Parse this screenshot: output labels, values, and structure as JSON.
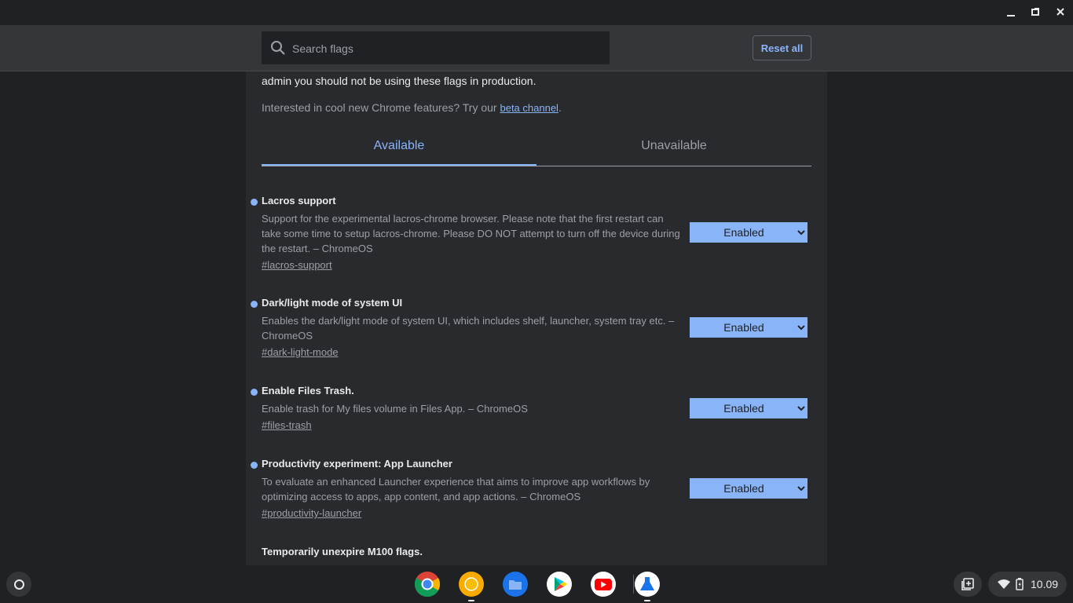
{
  "window": {
    "controls": [
      {
        "name": "minimize-icon"
      },
      {
        "name": "maximize-icon"
      },
      {
        "name": "close-icon"
      }
    ]
  },
  "toolbar": {
    "search_placeholder": "Search flags",
    "search_value": "",
    "reset_label": "Reset all"
  },
  "intro": {
    "warning_text": "admin you should not be using these flags in production.",
    "beta_prefix": "Interested in cool new Chrome features? Try our ",
    "beta_link": "beta channel",
    "beta_suffix": "."
  },
  "tabs": [
    {
      "label": "Available",
      "active": true
    },
    {
      "label": "Unavailable",
      "active": false
    }
  ],
  "flags": [
    {
      "name": "Lacros support",
      "description": "Support for the experimental lacros-chrome browser. Please note that the first restart can take some time to setup lacros-chrome. Please DO NOT attempt to turn off the device during the restart. – ChromeOS",
      "link": "#lacros-support",
      "value": "Enabled"
    },
    {
      "name": "Dark/light mode of system UI",
      "description": "Enables the dark/light mode of system UI, which includes shelf, launcher, system tray etc. – ChromeOS",
      "link": "#dark-light-mode",
      "value": "Enabled"
    },
    {
      "name": "Enable Files Trash.",
      "description": "Enable trash for My files volume in Files App. – ChromeOS",
      "link": "#files-trash",
      "value": "Enabled"
    },
    {
      "name": "Productivity experiment: App Launcher",
      "description": "To evaluate an enhanced Launcher experience that aims to improve app workflows by optimizing access to apps, app content, and app actions. – ChromeOS",
      "link": "#productivity-launcher",
      "value": "Enabled"
    },
    {
      "name": "Temporarily unexpire M100 flags.",
      "description": "",
      "link": "",
      "value": ""
    }
  ],
  "shelf": {
    "apps": [
      {
        "name": "chrome-icon",
        "indicator": false
      },
      {
        "name": "chrome-canary-icon",
        "indicator": true
      },
      {
        "name": "files-icon",
        "indicator": false
      },
      {
        "name": "play-store-icon",
        "indicator": false
      },
      {
        "name": "youtube-icon",
        "indicator": false
      },
      {
        "name": "chrome-flags-icon",
        "indicator": true
      }
    ],
    "clock": "10.09"
  },
  "colors": {
    "accent": "#8ab4f8",
    "background": "#202124",
    "surface": "#292a2d",
    "header": "#35363a"
  }
}
